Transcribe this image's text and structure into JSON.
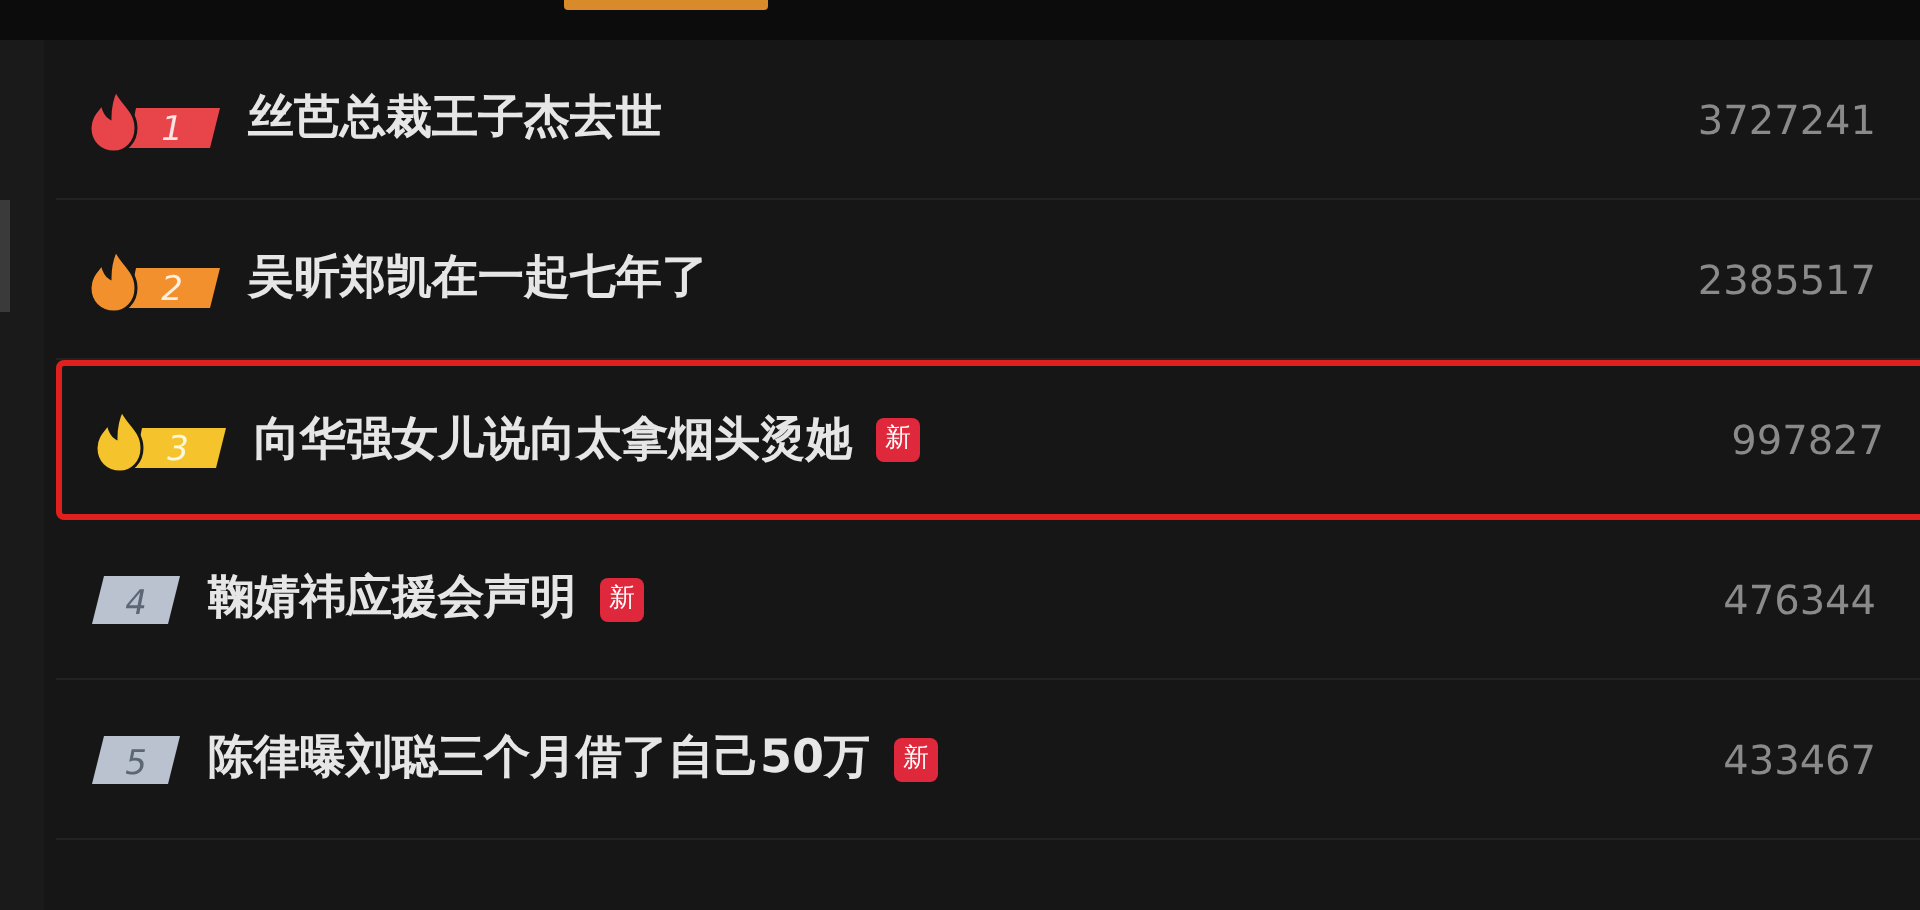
{
  "hot_list": [
    {
      "rank": "1",
      "kind": "flame",
      "color": "#e8454a",
      "title": "丝芭总裁王子杰去世",
      "new": false,
      "highlighted": false,
      "count": "3727241"
    },
    {
      "rank": "2",
      "kind": "flame",
      "color": "#f2902e",
      "title": "吴昕郑凯在一起七年了",
      "new": false,
      "highlighted": false,
      "count": "2385517"
    },
    {
      "rank": "3",
      "kind": "flame",
      "color": "#f5c42c",
      "title": "向华强女儿说向太拿烟头烫她",
      "new": true,
      "new_label": "新",
      "highlighted": true,
      "count": "997827"
    },
    {
      "rank": "4",
      "kind": "plain",
      "color": "#b9c2ce",
      "title": "鞠婧祎应援会声明",
      "new": true,
      "new_label": "新",
      "highlighted": false,
      "count": "476344"
    },
    {
      "rank": "5",
      "kind": "plain",
      "color": "#b9c2ce",
      "title": "陈律曝刘聪三个月借了自己50万",
      "new": true,
      "new_label": "新",
      "highlighted": false,
      "count": "433467"
    }
  ]
}
